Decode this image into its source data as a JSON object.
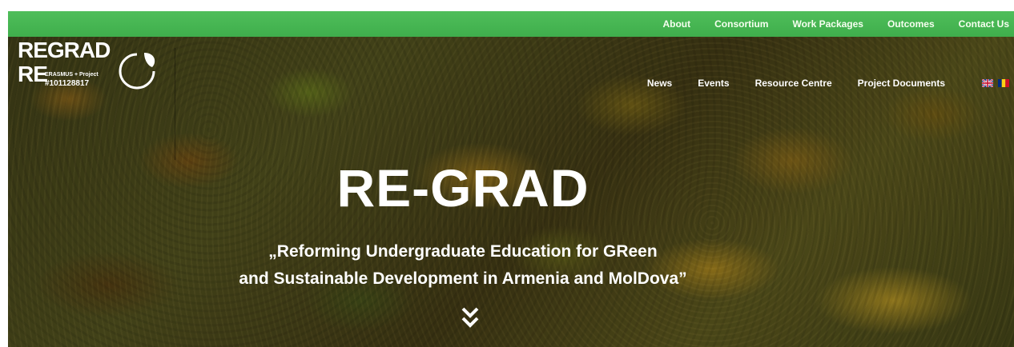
{
  "top_nav": {
    "items": [
      "About",
      "Consortium",
      "Work Packages",
      "Outcomes",
      "Contact Us"
    ]
  },
  "logo": {
    "re_top": "RE",
    "grad": "GRAD",
    "re_bottom": "RE",
    "program": "ERASMUS + Project",
    "project_id": "#101128817"
  },
  "main_nav": {
    "items": [
      "News",
      "Events",
      "Resource Centre",
      "Project Documents"
    ],
    "languages": [
      "english-flag-icon",
      "romanian-flag-icon"
    ]
  },
  "hero": {
    "title": "RE-GRAD",
    "subtitle_line1": "„Reforming Undergraduate Education for GReen",
    "subtitle_line2": "and Sustainable Development in Armenia and MolDova”",
    "scroll_icon": "double-chevron-down-icon"
  },
  "colors": {
    "top_bar": "#4fbe5a",
    "text": "#ffffff"
  }
}
